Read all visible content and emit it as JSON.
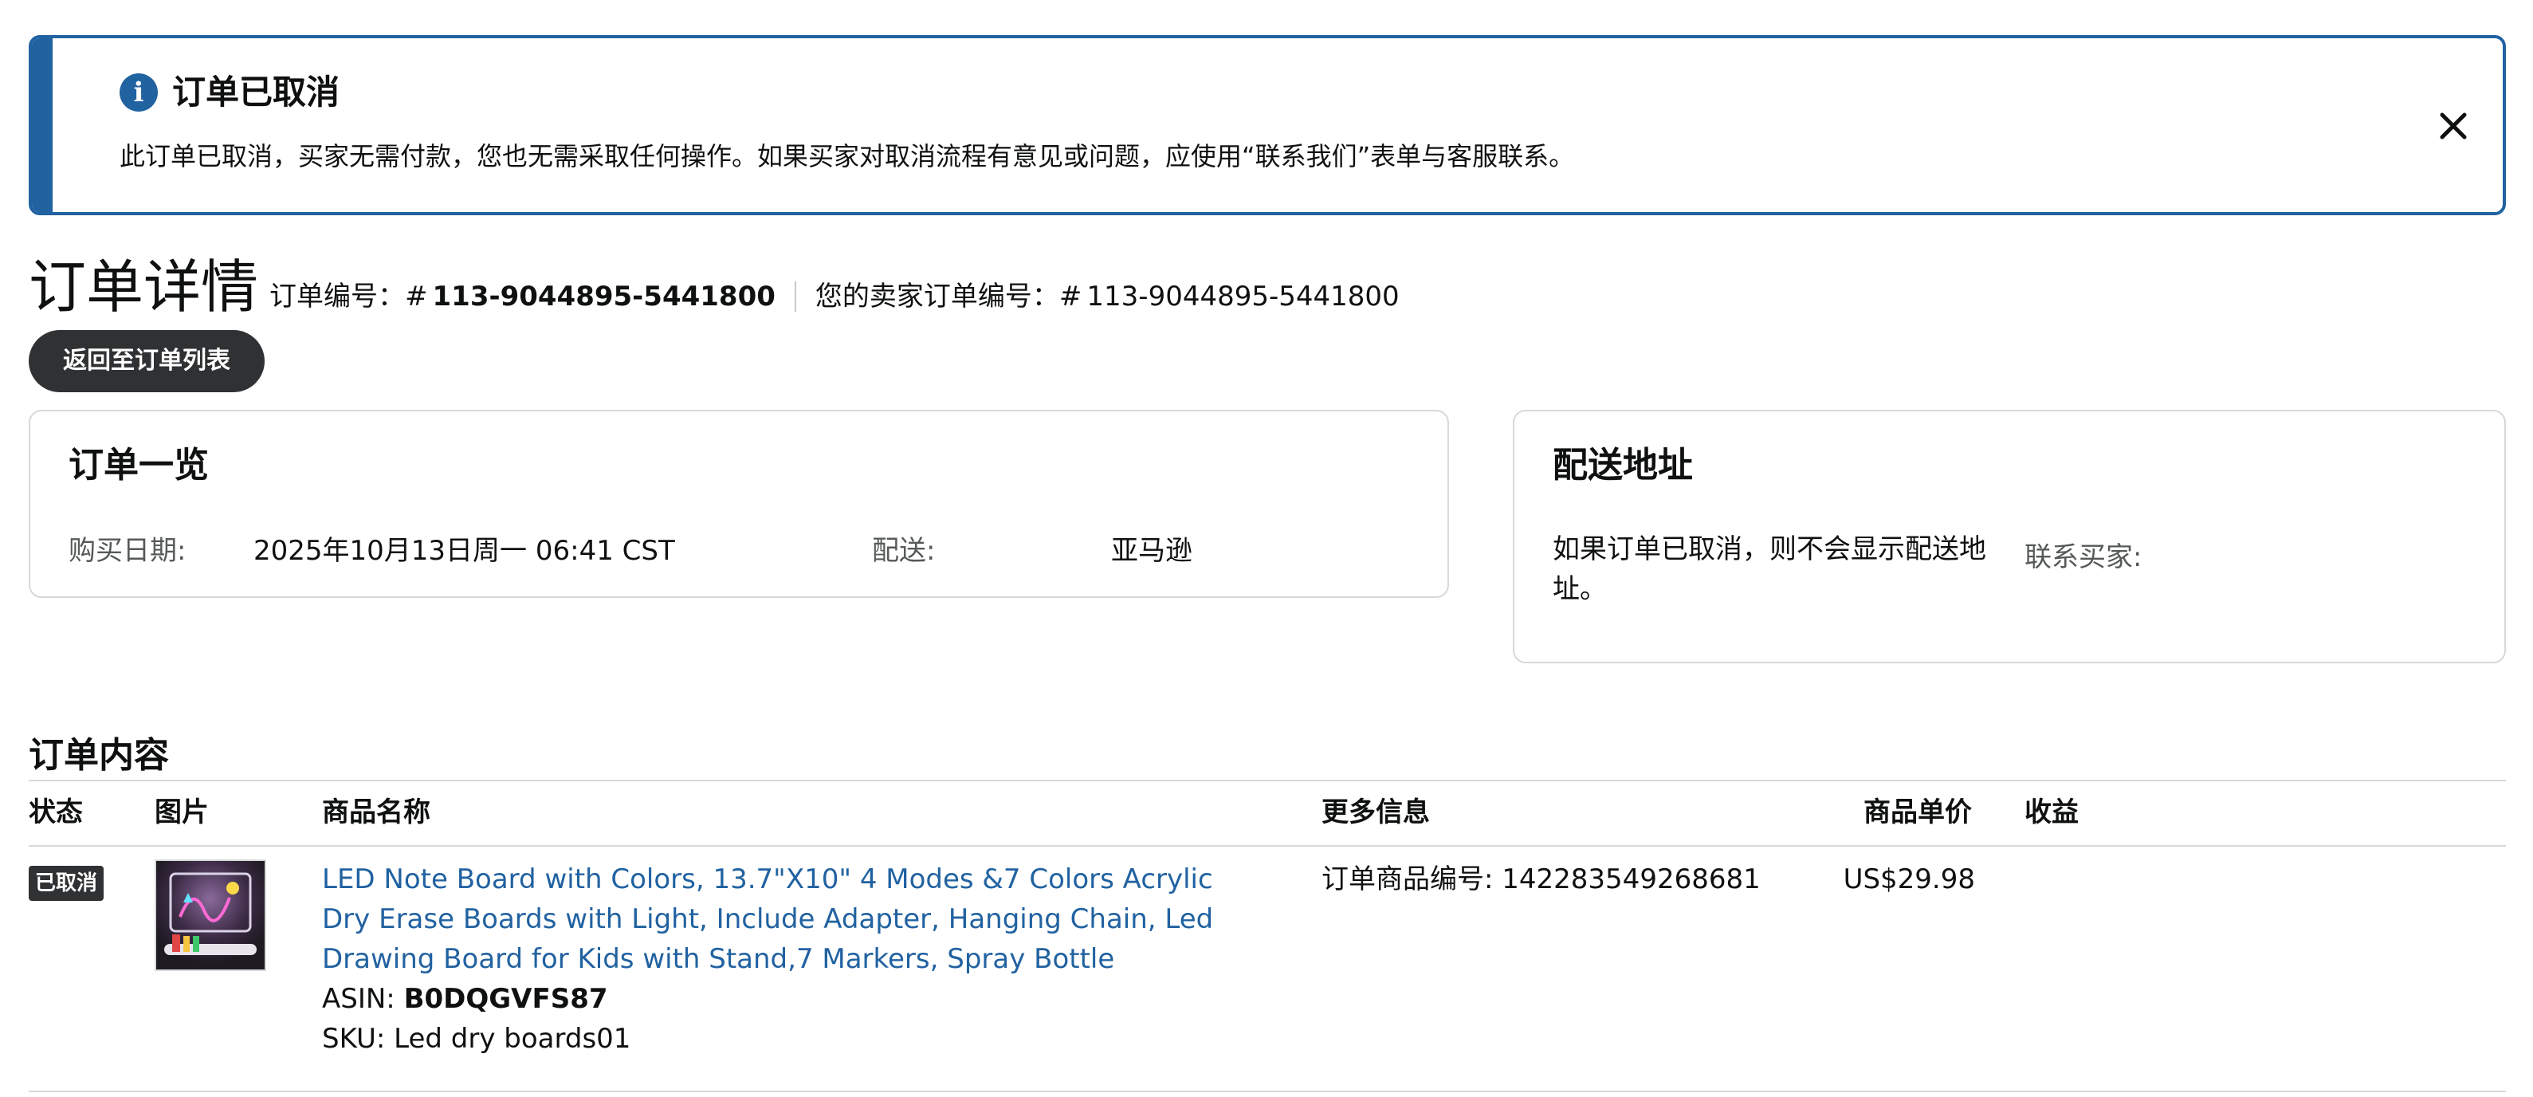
{
  "alert": {
    "icon": "info-icon",
    "icon_glyph": "i",
    "title": "订单已取消",
    "message": "此订单已取消，买家无需付款，您也无需采取任何操作。如果买家对取消流程有意见或问题，应使用“联系我们”表单与客服联系。",
    "close_icon": "close-icon",
    "accent_color": "#2162a1"
  },
  "header": {
    "title": "订单详情",
    "order_number_label": "订单编号：#",
    "order_number": "113-9044895-5441800",
    "seller_order_label": "您的卖家订单编号：#",
    "seller_order_number": "113-9044895-5441800",
    "back_button_label": "返回至订单列表"
  },
  "summary": {
    "title": "订单一览",
    "purchase_date_label": "购买日期:",
    "purchase_date_value": "2025年10月13日周一 06:41 CST",
    "shipping_label": "配送:",
    "shipping_value": "亚马逊"
  },
  "shipping": {
    "title": "配送地址",
    "message": "如果订单已取消，则不会显示配送地址。",
    "contact_buyer_label": "联系买家:"
  },
  "contents": {
    "title": "订单内容",
    "columns": {
      "status": "状态",
      "image": "图片",
      "product_name": "商品名称",
      "more_info": "更多信息",
      "unit_price": "商品单价",
      "proceeds": "收益"
    },
    "rows": [
      {
        "status": "已取消",
        "product_name": "LED Note Board with Colors, 13.7\"X10\" 4 Modes &7 Colors Acrylic Dry Erase Boards with Light, Include Adapter, Hanging Chain, Led Drawing Board for Kids with Stand,7 Markers, Spray Bottle",
        "asin_label": "ASIN: ",
        "asin": "B0DQGVFS87",
        "sku_label": "SKU: ",
        "sku": "Led dry boards01",
        "more_info_label": "订单商品编号: ",
        "order_item_id": "142283549268681",
        "unit_price": "US$29.98",
        "proceeds": ""
      }
    ]
  },
  "colors": {
    "link": "#2162a1",
    "dark_button": "#2f3133",
    "border": "#d5d9d9",
    "muted_text": "#565959"
  }
}
